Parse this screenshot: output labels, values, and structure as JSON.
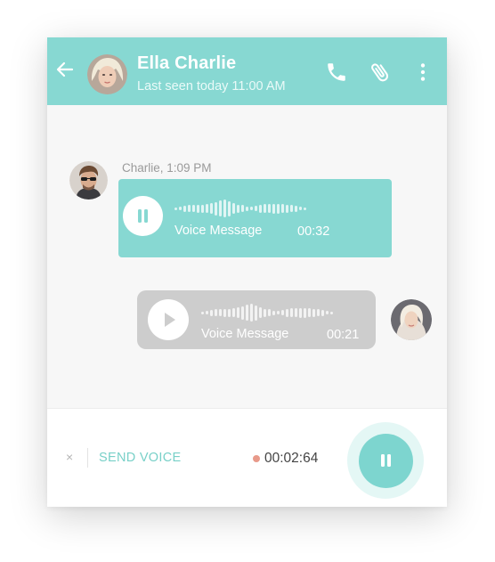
{
  "header": {
    "title": "Ella Charlie",
    "subtitle": "Last seen today 11:00 AM",
    "icons": [
      "back-arrow-icon",
      "phone-icon",
      "paperclip-icon",
      "more-vertical-icon"
    ]
  },
  "messages": [
    {
      "sender_line": "Charlie, 1:09 PM",
      "label": "Voice Message",
      "duration": "00:32",
      "state": "playing"
    },
    {
      "label": "Voice Message",
      "duration": "00:21",
      "state": "paused"
    }
  ],
  "footer": {
    "cancel": "×",
    "send_label": "SEND VOICE",
    "timer": "00:02:64"
  },
  "colors": {
    "accent": "#87d8d2",
    "incoming_bubble": "#87d8d2",
    "outgoing_bubble": "#cdcdcd",
    "recording_dot": "#e89a8a"
  }
}
